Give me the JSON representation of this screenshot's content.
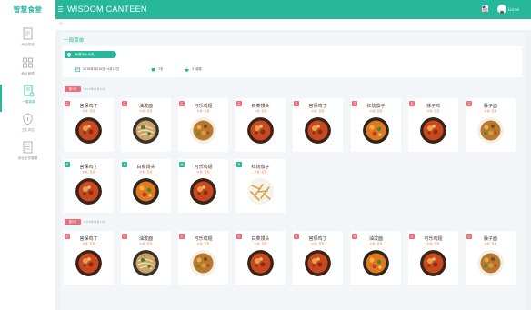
{
  "app": {
    "logo": "智慧食堂",
    "title": "WISDOM CANTEEN"
  },
  "header": {
    "username": "Lisrae",
    "flag_icon": "flag-icon",
    "menu_icon": "hamburger-icon"
  },
  "colors": {
    "brand": "#27b79a",
    "lunch_tag": "#ef6c78",
    "price": "#f08a4b"
  },
  "sidebar": {
    "items": [
      {
        "label": "添加菜谱",
        "icon": "document-icon",
        "active": false
      },
      {
        "label": "就业管理",
        "icon": "grid-icon",
        "active": false
      },
      {
        "label": "一周菜单",
        "icon": "menu-doc-icon",
        "active": true
      },
      {
        "label": "卫生评估",
        "icon": "shield-icon",
        "active": false
      },
      {
        "label": "综合业务管理",
        "icon": "clipboard-icon",
        "active": false
      }
    ]
  },
  "breadcrumb": {
    "icon": "home-icon",
    "label": "Hi"
  },
  "page": {
    "title": "一周菜单",
    "unit_name": "海滨市水水队",
    "date_range": "2018年9月10日~9月17日",
    "days": "7天",
    "dish_count": "31道菜",
    "date_icon": "calendar-icon",
    "days_icon": "cup-icon",
    "count_icon": "bowl-icon"
  },
  "days": [
    {
      "badge": "第1天",
      "date": "2018年09月10日",
      "dishes": [
        {
          "meal": "午",
          "name": "宫保鸡丁",
          "price": "价格: 荤菜",
          "photo": "red-sauce"
        },
        {
          "meal": "午",
          "name": "油泼面",
          "price": "价格: 荤菜",
          "photo": "noodles"
        },
        {
          "meal": "午",
          "name": "可乐鸡翅",
          "price": "价格: 荤菜",
          "photo": "wings"
        },
        {
          "meal": "午",
          "name": "白菜馒头",
          "price": "价格: 荤菜",
          "photo": "red-sauce"
        },
        {
          "meal": "午",
          "name": "宫保鸡丁",
          "price": "价格: 荤菜",
          "photo": "red-sauce"
        },
        {
          "meal": "午",
          "name": "红烧茄子",
          "price": "价格: 荤菜",
          "photo": "veggie"
        },
        {
          "meal": "午",
          "name": "辣子鸡",
          "price": "价格: 荤菜",
          "photo": "red-sauce"
        },
        {
          "meal": "午",
          "name": "臊子面",
          "price": "价格: 荤菜",
          "photo": "wings"
        },
        {
          "meal": "早",
          "name": "宫保鸡丁",
          "price": "价格: 荤菜",
          "photo": "red-sauce"
        },
        {
          "meal": "早",
          "name": "白菜馒头",
          "price": "价格: 荤菜",
          "photo": "veggie"
        },
        {
          "meal": "早",
          "name": "可乐鸡翅",
          "price": "价格: 荤菜",
          "photo": "red-sauce"
        },
        {
          "meal": "早",
          "name": "红烧茄子",
          "price": "价格: 荤菜",
          "photo": "fries"
        }
      ]
    },
    {
      "badge": "第2天",
      "date": "2018年09月11日",
      "dishes": [
        {
          "meal": "午",
          "name": "宫保鸡丁",
          "price": "价格: 荤菜",
          "photo": "red-sauce"
        },
        {
          "meal": "午",
          "name": "油泼面",
          "price": "价格: 荤菜",
          "photo": "noodles"
        },
        {
          "meal": "午",
          "name": "可乐鸡翅",
          "price": "价格: 荤菜",
          "photo": "wings"
        },
        {
          "meal": "午",
          "name": "白菜馒头",
          "price": "价格: 荤菜",
          "photo": "red-sauce"
        },
        {
          "meal": "午",
          "name": "宫保鸡丁",
          "price": "价格: 荤菜",
          "photo": "red-sauce"
        },
        {
          "meal": "午",
          "name": "油泼面",
          "price": "价格: 荤菜",
          "photo": "veggie"
        },
        {
          "meal": "午",
          "name": "可乐鸡翅",
          "price": "价格: 荤菜",
          "photo": "red-sauce"
        },
        {
          "meal": "午",
          "name": "臊子面",
          "price": "价格: 荤菜",
          "photo": "wings"
        }
      ]
    }
  ]
}
